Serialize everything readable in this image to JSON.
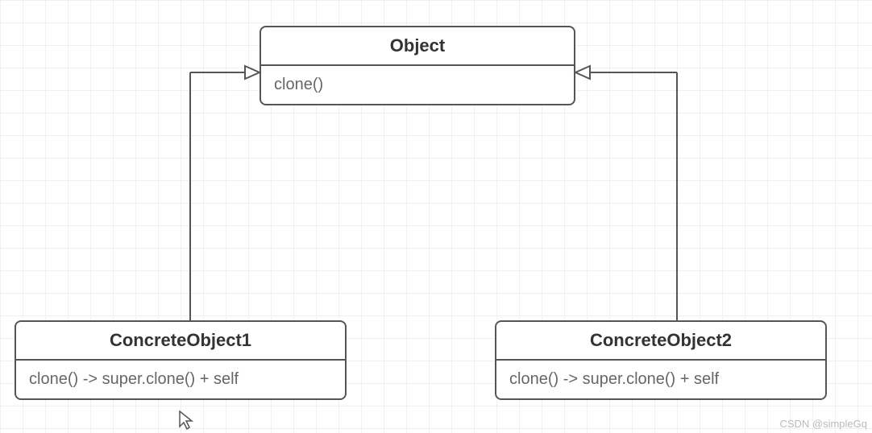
{
  "parent": {
    "title": "Object",
    "method": "clone()"
  },
  "child1": {
    "title": "ConcreteObject1",
    "method": "clone() -> super.clone() + self"
  },
  "child2": {
    "title": "ConcreteObject2",
    "method": "clone() -> super.clone() + self"
  },
  "watermark": "CSDN @simpleGq"
}
